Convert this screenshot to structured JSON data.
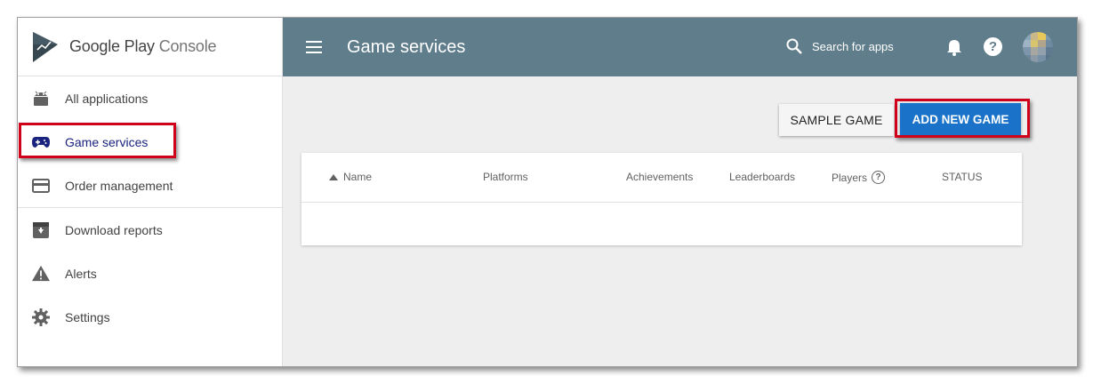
{
  "brand": {
    "name_primary": "Google Play",
    "name_secondary": "Console"
  },
  "sidebar": {
    "items": [
      {
        "label": "All applications",
        "icon": "android-icon"
      },
      {
        "label": "Game services",
        "icon": "gamepad-icon",
        "active": true
      },
      {
        "label": "Order management",
        "icon": "credit-card-icon"
      },
      {
        "label": "Download reports",
        "icon": "download-box-icon"
      },
      {
        "label": "Alerts",
        "icon": "warning-icon"
      },
      {
        "label": "Settings",
        "icon": "gear-icon"
      }
    ]
  },
  "topbar": {
    "title": "Game services",
    "search_placeholder": "Search for apps",
    "help_glyph": "?"
  },
  "actions": {
    "sample_game": "SAMPLE GAME",
    "add_new_game": "ADD NEW GAME"
  },
  "table": {
    "columns": [
      "Name",
      "Platforms",
      "Achievements",
      "Leaderboards",
      "Players",
      "STATUS"
    ],
    "rows": []
  },
  "colors": {
    "topbar": "#607d8b",
    "primary_button": "#1a73c8",
    "highlight": "#d0021b",
    "active_nav": "#1a237e"
  }
}
